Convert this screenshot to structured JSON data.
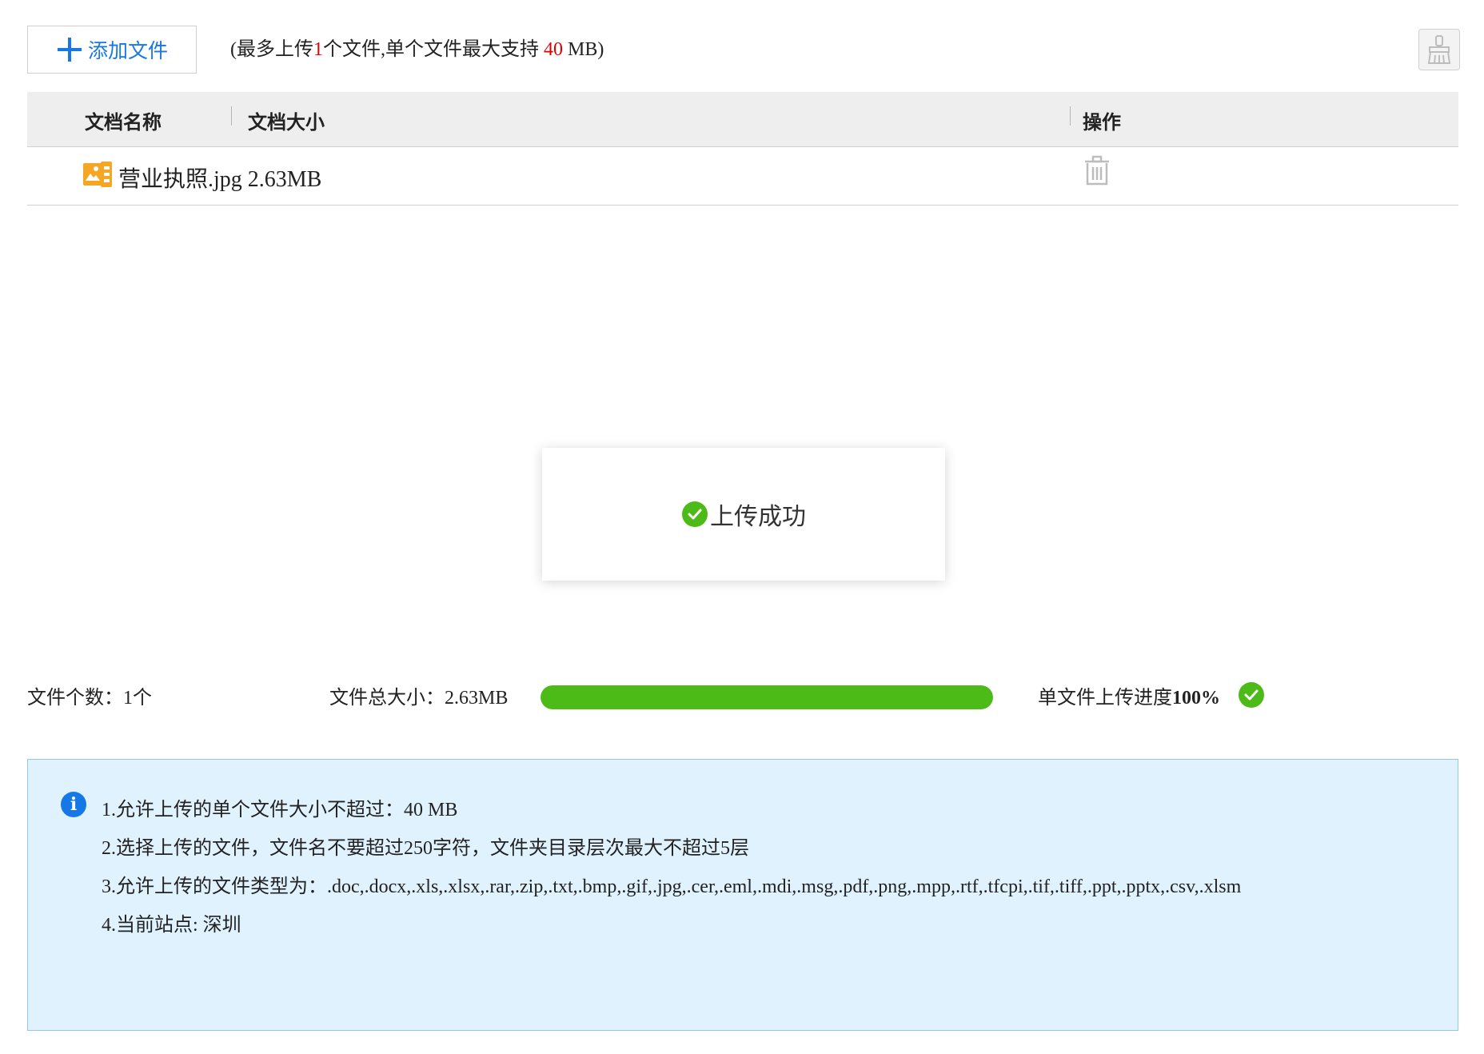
{
  "toolbar": {
    "add_label": "添加文件",
    "limit_prefix": "(最多上传",
    "limit_count": "1",
    "limit_middle": "个文件,单个文件最大支持 ",
    "limit_size": "40",
    "limit_suffix": " MB)",
    "clear_icon": "broom-icon"
  },
  "table": {
    "headers": {
      "name": "文档名称",
      "size": "文档大小",
      "action": "操作"
    },
    "rows": [
      {
        "name": "营业执照.jpg",
        "size": "2.63MB",
        "icon": "image-file-icon",
        "action_icon": "trash-icon"
      }
    ]
  },
  "toast": {
    "message": "上传成功",
    "icon": "success-check-icon"
  },
  "stats": {
    "count_label": "文件个数：1个",
    "total_label": "文件总大小：2.63MB",
    "progress_fraction": 1.0,
    "progress_label_prefix": "单文件上传进度",
    "progress_percent": "100%"
  },
  "info": {
    "lines": [
      "1.允许上传的单个文件大小不超过：40 MB",
      "2.选择上传的文件，文件名不要超过250字符，文件夹目录层次最大不超过5层",
      "3.允许上传的文件类型为：.doc,.docx,.xls,.xlsx,.rar,.zip,.txt,.bmp,.gif,.jpg,.cer,.eml,.mdi,.msg,.pdf,.png,.mpp,.rtf,.tfcpi,.tif,.tiff,.ppt,.pptx,.csv,.xlsm",
      "4.当前站点: 深圳"
    ]
  },
  "colors": {
    "accent": "#1677e6",
    "success": "#4cbb17",
    "limit_red": "#e00000",
    "info_bg": "#dff2fe",
    "file_icon": "#f5a623"
  }
}
